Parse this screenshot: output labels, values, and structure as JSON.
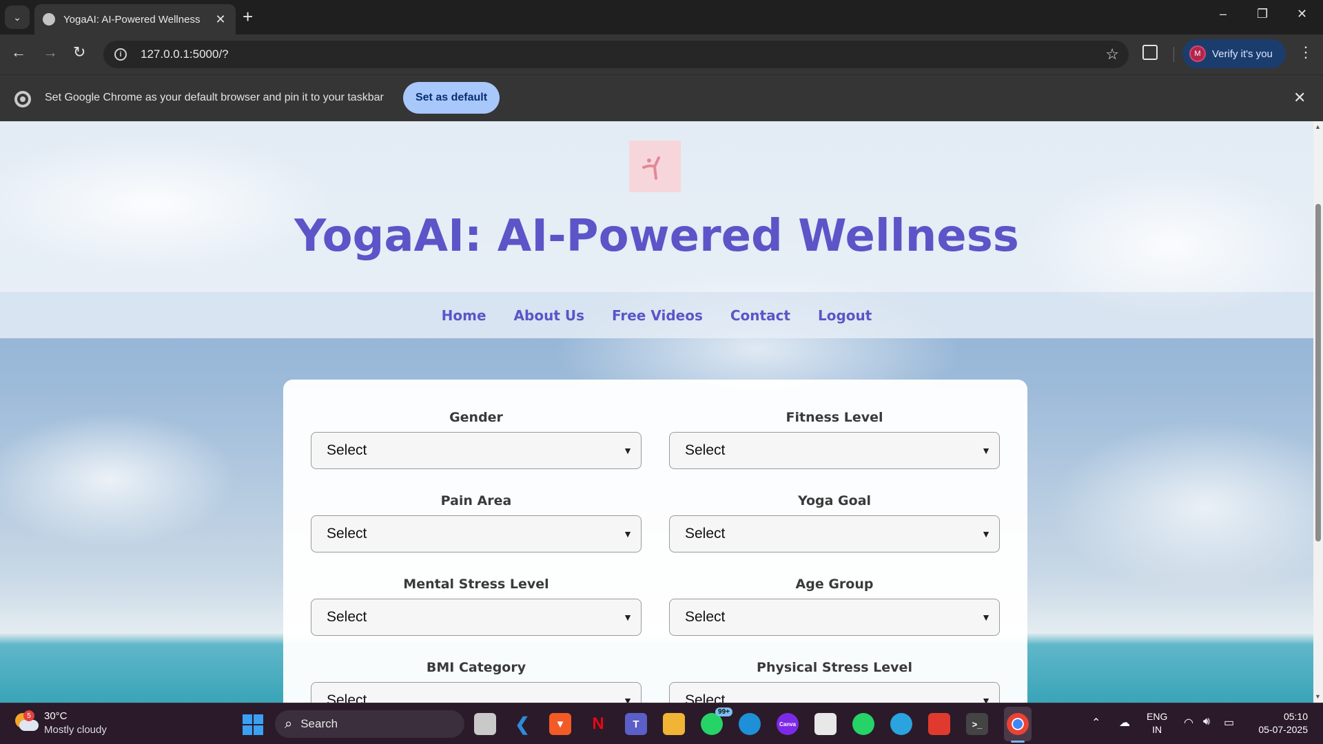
{
  "browser": {
    "tab_title": "YogaAI: AI-Powered Wellness",
    "url": "127.0.0.1:5000/?",
    "profile_initial": "M",
    "verify_label": "Verify it's you",
    "infobar_text": "Set Google Chrome as your default browser and pin it to your taskbar",
    "infobar_button": "Set as default"
  },
  "page": {
    "title": "YogaAI: AI-Powered Wellness",
    "nav": [
      "Home",
      "About Us",
      "Free Videos",
      "Contact",
      "Logout"
    ],
    "form": {
      "fields": [
        {
          "label": "Gender",
          "value": "Select"
        },
        {
          "label": "Fitness Level",
          "value": "Select"
        },
        {
          "label": "Pain Area",
          "value": "Select"
        },
        {
          "label": "Yoga Goal",
          "value": "Select"
        },
        {
          "label": "Mental Stress Level",
          "value": "Select"
        },
        {
          "label": "Age Group",
          "value": "Select"
        },
        {
          "label": "BMI Category",
          "value": "Select"
        },
        {
          "label": "Physical Stress Level",
          "value": "Select"
        }
      ]
    }
  },
  "taskbar": {
    "weather_badge": "5",
    "temperature": "30°C",
    "weather": "Mostly cloudy",
    "search_label": "Search",
    "whatsapp_badge": "99+",
    "canva_label": "Canva",
    "language_line1": "ENG",
    "language_line2": "IN",
    "time": "05:10",
    "date": "05-07-2025"
  },
  "colors": {
    "brand_purple": "#5b55c8",
    "chrome_accent": "#a8c7fa"
  },
  "icons": [
    "tab-search-icon",
    "back-icon",
    "forward-icon",
    "reload-icon",
    "info-icon",
    "star-icon",
    "extensions-icon",
    "menu-icon",
    "yoga-logo-icon",
    "windows-start-icon",
    "search-icon"
  ]
}
